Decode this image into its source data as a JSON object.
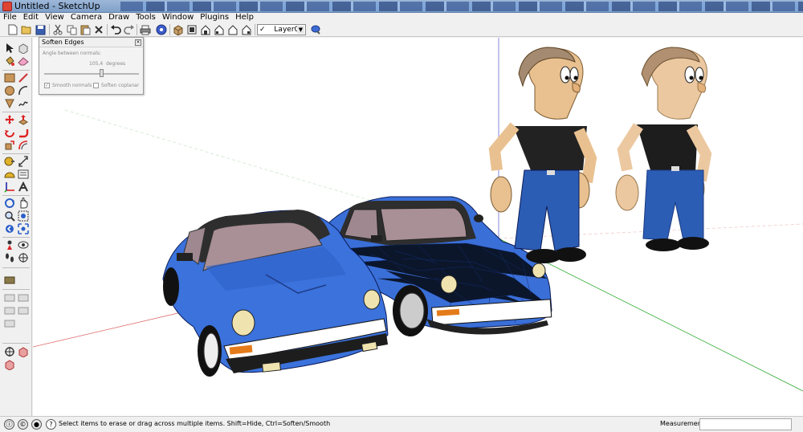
{
  "window": {
    "title": "Untitled - SketchUp"
  },
  "menu": [
    "File",
    "Edit",
    "View",
    "Camera",
    "Draw",
    "Tools",
    "Window",
    "Plugins",
    "Help"
  ],
  "toolbar": {
    "layer": {
      "check": "✓",
      "value": "Layer0"
    },
    "icons": [
      "new-icon",
      "open-icon",
      "save-icon",
      "cut-icon",
      "copy-icon",
      "paste-icon",
      "erase-icon",
      "undo-icon",
      "redo-icon",
      "print-icon",
      "model-info-icon",
      "iso-view-icon",
      "top-view-icon",
      "front-view-icon",
      "right-view-icon",
      "back-view-icon",
      "left-view-icon",
      "layer-manager-icon"
    ]
  },
  "soften_edges": {
    "title": "Soften Edges",
    "angle_label": "Angle between normals:",
    "angle_value": "105,4",
    "angle_unit": "degrees",
    "slider_fraction": 0.6,
    "smooth_normals_label": "Smooth normals",
    "smooth_normals_checked": true,
    "soften_coplanar_label": "Soften coplanar",
    "soften_coplanar_checked": false
  },
  "status": {
    "text": "Select items to erase or drag across multiple items. Shift=Hide, Ctrl=Soften/Smooth",
    "measurements_label": "Measurements",
    "measurements_value": ""
  },
  "colors": {
    "car_blue": "#3a6fd8",
    "car_roof": "#303030",
    "pants_blue": "#2c5db5",
    "skin": "#e9c190",
    "axis_red": "#d33",
    "axis_green": "#2a2",
    "axis_blue": "#33c"
  }
}
